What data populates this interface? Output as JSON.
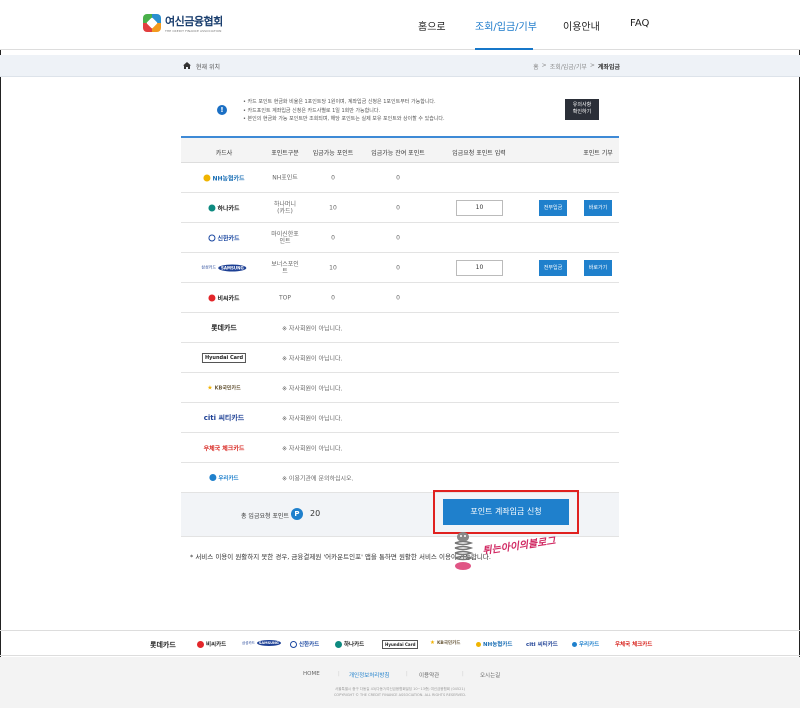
{
  "header": {
    "logo_title": "여신금융협회",
    "logo_sub": "THE CREDIT FINANCE ASSOCIATION",
    "nav": [
      "홈으로",
      "조회/입금/기부",
      "이용안내",
      "FAQ"
    ],
    "active_index": 1
  },
  "breadcrumb": {
    "here_label": "현재 위치",
    "path": [
      "홈",
      ">",
      "조회/입금/기부",
      ">",
      "계좌입금"
    ]
  },
  "notice": {
    "lines": [
      "카드 포인트 현금화 비율은 1포인트당 1원이며, 계좌입금 신청은 1포인트부터 가능합니다.",
      "카드포인트 계좌입금 신청은 카드사별로 1일 1회만 가능합니다.",
      "본인의 현금화 가능 포인트만 조회되며, 해당 포인트는 실제 보유 포인트와 상이할 수 있습니다."
    ],
    "button": [
      "유의사항",
      "확인하기"
    ]
  },
  "table": {
    "headers": [
      "카드사",
      "포인트구분",
      "입금가능 포인트",
      "입금가능 잔여 포인트",
      "입금요청 포인트 입력",
      "포인트 기부"
    ],
    "rows": [
      {
        "card": "NH농협카드",
        "color": "#1b6fb5",
        "type": "NH포인트",
        "avail": "0",
        "remain": "0"
      },
      {
        "card": "하나카드",
        "color": "#0d8a80",
        "type": "하나머니\n(카드)",
        "avail": "10",
        "remain": "0",
        "input": "10",
        "btn1": "전부입금",
        "btn2": "바로가기"
      },
      {
        "card": "신한카드",
        "color": "#1a47a0",
        "type": "마이신한포\n인트",
        "avail": "0",
        "remain": "0"
      },
      {
        "card": "SAMSUNG",
        "color": "#1c3f94",
        "type": "보너스포인\n트",
        "avail": "10",
        "remain": "0",
        "input": "10",
        "btn1": "전부입금",
        "btn2": "바로가기"
      },
      {
        "card": "비씨카드",
        "color": "#e3262a",
        "type": "TOP",
        "avail": "0",
        "remain": "0"
      },
      {
        "card": "롯데카드",
        "color": "#222222",
        "msg": "※ 자사회원이 아닙니다."
      },
      {
        "card": "Hyundai Card",
        "color": "#222222",
        "msg": "※ 자사회원이 아닙니다."
      },
      {
        "card": "KB국민카드",
        "color": "#6a5a3c",
        "msg": "※ 자사회원이 아닙니다."
      },
      {
        "card": "citi 씨티카드",
        "color": "#1c3f94",
        "msg": "※ 자사회원이 아닙니다."
      },
      {
        "card": "우체국 체크카드",
        "color": "#d8251f",
        "msg": "※ 자사회원이 아닙니다."
      },
      {
        "card": "우리카드",
        "color": "#1f80cc",
        "msg": "※ 이용기관에 문의하십시오."
      }
    ],
    "total_label": "총 입금요청 포인트",
    "total_badge": "P",
    "total_value": "20",
    "submit_label": "포인트 계좌입금 신청"
  },
  "footnote": "* 서비스 이용이 원활하지 못한 경우, 금융결제원 '어카운트인포' 앱을 통하면 원활한 서비스 이용이 가능합니다.",
  "watermark": "튀는아이의블로그",
  "footer": {
    "logos": [
      "롯데카드",
      "비씨카드",
      "SAMSUNG",
      "신한카드",
      "하나카드",
      "Hyundai Card",
      "KB국민카드",
      "NH농협카드",
      "citi 씨티카드",
      "우리카드",
      "우체국 체크카드"
    ],
    "links": [
      "HOME",
      "개인정보처리방침",
      "이용약관",
      "오시는길"
    ],
    "address": "서울특별시 중구 다동길 43(다동7/여신금융협회빌딩 10~13층) 여신금융협회 (04521)",
    "copyright": "COPYRIGHT © THE CREDIT FINANCE ASSOCIATION. ALL RIGHTS RESERVED."
  },
  "colors": {
    "accent": "#1f80cc",
    "highlight": "#e0211f",
    "dark_button": "#2b2f38"
  }
}
